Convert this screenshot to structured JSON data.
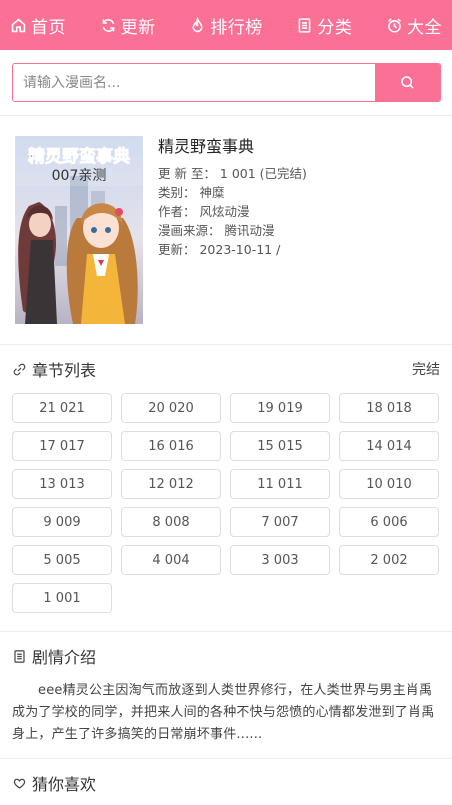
{
  "nav": {
    "items": [
      {
        "label": "首页",
        "icon": "home-icon"
      },
      {
        "label": "更新",
        "icon": "refresh-icon"
      },
      {
        "label": "排行榜",
        "icon": "fire-icon"
      },
      {
        "label": "分类",
        "icon": "list-icon"
      },
      {
        "label": "大全",
        "icon": "clock-icon"
      }
    ]
  },
  "search": {
    "placeholder": "请输入漫画名...",
    "value": ""
  },
  "comic": {
    "title": "精灵野蛮事典",
    "latest": "更  新  至：  1 001 (已完结)",
    "category": "类别：  神糜",
    "author": "作者：  风炫动漫",
    "source": "漫画来源：  腾讯动漫",
    "updated": "更新：  2023-10-11  /",
    "cover": {
      "title_text": "精灵野蛮事典",
      "subtitle_text": "007亲测"
    }
  },
  "chapters_section": {
    "title": "章节列表",
    "status": "完结",
    "items": [
      "21 021",
      "20 020",
      "19 019",
      "18 018",
      "17 017",
      "16 016",
      "15 015",
      "14 014",
      "13 013",
      "12 012",
      "11 011",
      "10 010",
      "9 009",
      "8 008",
      "7 007",
      "6 006",
      "5 005",
      "4 004",
      "3 003",
      "2 002",
      "1 001"
    ]
  },
  "synopsis_section": {
    "title": "剧情介绍",
    "text": "eee精灵公主因淘气而放逐到人类世界修行，在人类世界与男主肖禹成为了学校的同学，并把来人间的各种不快与怨愤的心情都发泄到了肖禹身上，产生了许多搞笑的日常崩坏事件......"
  },
  "recommend_section": {
    "title": "猜你喜欢"
  },
  "colors": {
    "accent": "#fb7196",
    "divider": "#ececec"
  }
}
